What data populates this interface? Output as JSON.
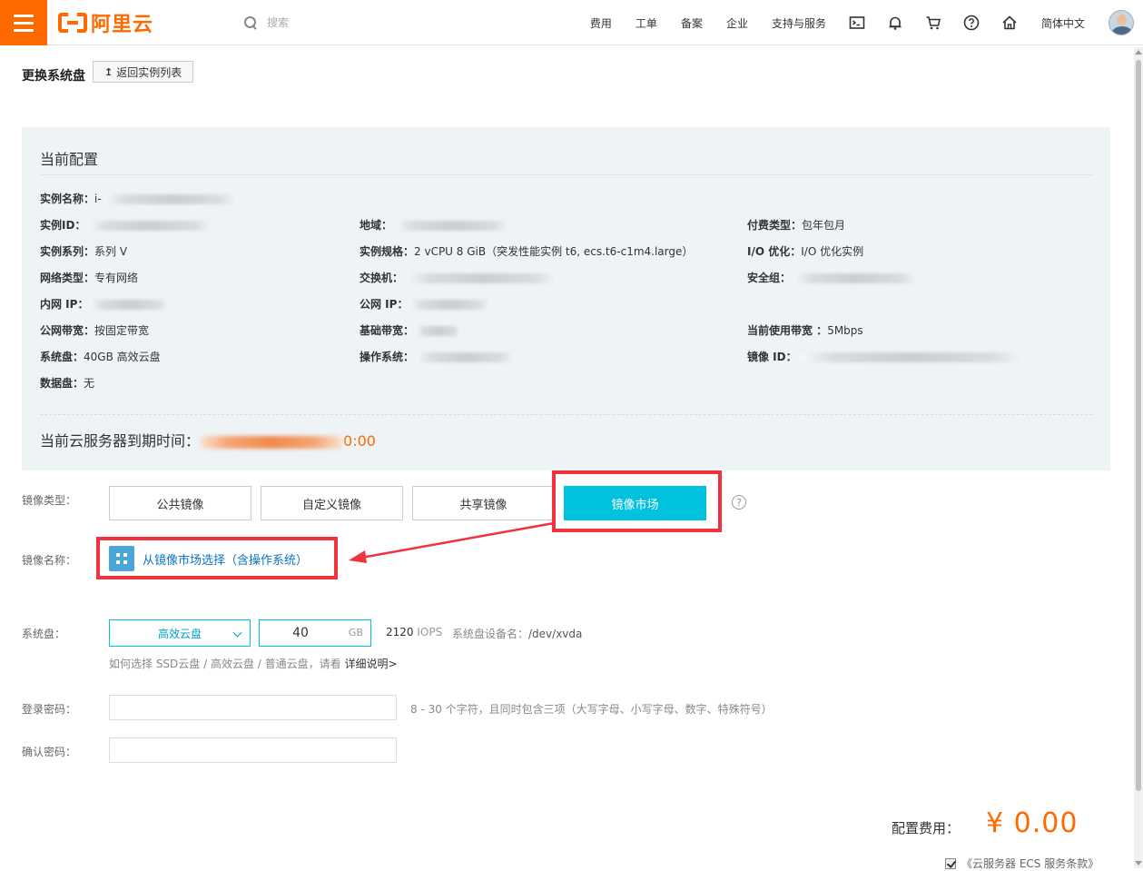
{
  "header": {
    "logo_text": "阿里云",
    "search_placeholder": "搜索",
    "nav": [
      "费用",
      "工单",
      "备案",
      "企业",
      "支持与服务"
    ],
    "language": "简体中文",
    "brand_color": "#ff6a00"
  },
  "page": {
    "title": "更换系统盘",
    "back_label": "返回实例列表"
  },
  "config": {
    "title": "当前配置",
    "instance_name": {
      "label": "实例名称：",
      "value": "i-"
    },
    "instance_id": {
      "label": "实例ID：",
      "value": ""
    },
    "region": {
      "label": "地域：",
      "value": ""
    },
    "billing": {
      "label": "付费类型：",
      "value": "包年包月"
    },
    "family": {
      "label": "实例系列：",
      "value": "系列 V"
    },
    "spec": {
      "label": "实例规格：",
      "value": "2 vCPU 8 GiB（突发性能实例 t6, ecs.t6-c1m4.large）"
    },
    "io_opt": {
      "label": "I/O 优化：",
      "value": "I/O 优化实例"
    },
    "network_type": {
      "label": "网络类型：",
      "value": "专有网络"
    },
    "vswitch": {
      "label": "交换机：",
      "value": ""
    },
    "security_group": {
      "label": "安全组：",
      "value": ""
    },
    "private_ip": {
      "label": "内网 IP：",
      "value": ""
    },
    "public_ip": {
      "label": "公网 IP：",
      "value": ""
    },
    "bandwidth_type": {
      "label": "公网带宽：",
      "value": "按固定带宽"
    },
    "base_bandwidth": {
      "label": "基础带宽：",
      "value": ""
    },
    "current_bandwidth": {
      "label": "当前使用带宽 ：",
      "value": "5Mbps"
    },
    "system_disk": {
      "label": "系统盘：",
      "value": "40GB 高效云盘"
    },
    "os": {
      "label": "操作系统：",
      "value": ""
    },
    "image_id": {
      "label": "镜像 ID：",
      "value": ""
    },
    "data_disk": {
      "label": "数据盘：",
      "value": "无"
    },
    "expire_label": "当前云服务器到期时间：",
    "expire_tail": "0:00"
  },
  "form": {
    "image_type_label": "镜像类型：",
    "image_tabs": [
      "公共镜像",
      "自定义镜像",
      "共享镜像",
      "镜像市场"
    ],
    "active_tab_index": 3,
    "image_name_label": "镜像名称：",
    "market_link": "从镜像市场选择（含操作系统）",
    "system_disk_label": "系统盘：",
    "disk_type": "高效云盘",
    "disk_size": "40",
    "disk_unit": "GB",
    "iops_value": "2120",
    "iops_unit": "IOPS",
    "device_label": "系统盘设备名：",
    "device_value": "/dev/xvda",
    "disk_hint": "如何选择 SSD云盘 / 高效云盘 / 普通云盘，请看",
    "disk_hint_link": "详细说明>",
    "password_label": "登录密码：",
    "password_hint": "8 - 30 个字符，且同时包含三项（大写字母、小写字母、数字、特殊符号）",
    "confirm_label": "确认密码：",
    "fee_label": "配置费用：",
    "fee_value": "¥  0.00",
    "terms": "《云服务器 ECS 服务条款》",
    "accent_color": "#00c1de",
    "highlight_color": "#f0323c"
  }
}
